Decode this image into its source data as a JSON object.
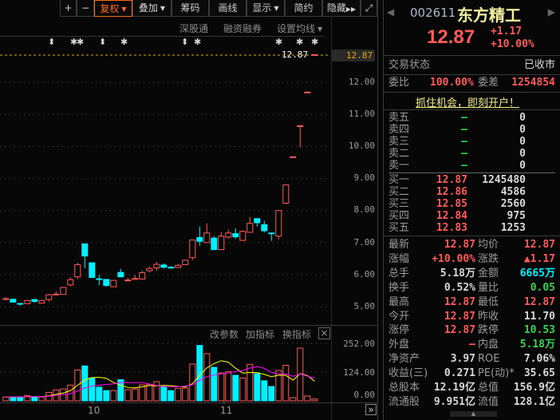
{
  "toolbar": {
    "plus": "+",
    "minus": "−",
    "fuquan": "复权",
    "diejia": "叠加",
    "chouma": "筹码",
    "huaxian": "画线",
    "xianshi": "显示",
    "jianyue": "简约",
    "yincang": "隐藏",
    "fullscreen_icon": "expand-icon"
  },
  "subbar": {
    "sgt": "深股通",
    "rzrq": "融资融券",
    "ma": "设置均线"
  },
  "markers": [
    "⬍",
    "✱",
    "✱",
    "⬍",
    "✱",
    "⬍",
    "✱",
    "✱",
    "✱",
    "✱"
  ],
  "last_label": "12.87",
  "price_axis": {
    "current": "12.87",
    "ticks": [
      "12.00",
      "11.00",
      "10.00",
      "9.00",
      "8.00",
      "7.00",
      "6.00",
      "5.00"
    ]
  },
  "vol_bar": {
    "params": "改参数",
    "add": "加指标",
    "switch": "换指标",
    "close": "×"
  },
  "vol_axis": [
    "252.00",
    "124.00",
    "0.00"
  ],
  "dates": [
    "10",
    "11"
  ],
  "next_btn": "»",
  "chart_data": {
    "type": "candlestick",
    "ylim": [
      5,
      12.87
    ],
    "up_color": "#ff5a5a",
    "down_color": "#00f0ff",
    "ohlc": [
      [
        5.22,
        5.3,
        5.22,
        5.25
      ],
      [
        5.23,
        5.25,
        5.13,
        5.14
      ],
      [
        5.1,
        5.11,
        5.03,
        5.09
      ],
      [
        5.09,
        5.21,
        5.09,
        5.19
      ],
      [
        5.22,
        5.25,
        5.12,
        5.16
      ],
      [
        5.11,
        5.21,
        5.1,
        5.19
      ],
      [
        5.22,
        5.4,
        5.16,
        5.37
      ],
      [
        5.37,
        5.47,
        5.37,
        5.39
      ],
      [
        5.38,
        5.6,
        5.38,
        5.6
      ],
      [
        5.68,
        5.92,
        5.63,
        5.84
      ],
      [
        5.93,
        6.37,
        5.86,
        6.31
      ],
      [
        6.96,
        6.97,
        6.2,
        6.58
      ],
      [
        6.37,
        6.37,
        5.91,
        5.91
      ],
      [
        5.87,
        6.0,
        5.67,
        5.86
      ],
      [
        5.85,
        5.85,
        5.62,
        5.66
      ],
      [
        5.62,
        5.82,
        5.62,
        5.82
      ],
      [
        6.07,
        6.18,
        5.93,
        5.93
      ],
      [
        5.82,
        5.9,
        5.8,
        5.83
      ],
      [
        5.85,
        5.98,
        5.85,
        5.88
      ],
      [
        5.86,
        6.13,
        5.86,
        6.06
      ],
      [
        6.12,
        6.25,
        6.06,
        6.19
      ],
      [
        6.21,
        6.4,
        6.12,
        6.32
      ],
      [
        6.3,
        6.35,
        6.18,
        6.23
      ],
      [
        6.23,
        6.27,
        6.2,
        6.22
      ],
      [
        6.22,
        6.33,
        6.22,
        6.29
      ],
      [
        6.31,
        6.45,
        6.31,
        6.45
      ],
      [
        6.53,
        7.08,
        6.45,
        7.08
      ],
      [
        7.16,
        7.5,
        6.9,
        7.04
      ],
      [
        7.0,
        7.6,
        7.0,
        7.3
      ],
      [
        7.14,
        7.2,
        6.76,
        6.78
      ],
      [
        6.78,
        7.33,
        6.78,
        7.2
      ],
      [
        7.17,
        7.4,
        7.12,
        7.3
      ],
      [
        7.28,
        7.45,
        7.12,
        7.18
      ],
      [
        7.07,
        7.38,
        7.05,
        7.35
      ],
      [
        7.32,
        7.8,
        7.32,
        7.6
      ],
      [
        7.75,
        7.75,
        7.5,
        7.62
      ],
      [
        7.56,
        7.68,
        7.31,
        7.37
      ],
      [
        7.3,
        7.32,
        7.05,
        7.29
      ],
      [
        7.2,
        8.0,
        7.1,
        8.0
      ],
      [
        8.23,
        8.8,
        8.2,
        8.8
      ],
      [
        9.68,
        9.68,
        9.68,
        9.68
      ],
      [
        10.65,
        10.65,
        9.98,
        10.65
      ],
      [
        11.7,
        11.7,
        11.7,
        11.7
      ],
      [
        12.87,
        12.87,
        12.87,
        12.87
      ]
    ],
    "volume": [
      17,
      17,
      17,
      23,
      17,
      17,
      37,
      48,
      52,
      69,
      135,
      153,
      100,
      60,
      45,
      45,
      93,
      49,
      52,
      70,
      72,
      84,
      61,
      45,
      55,
      56,
      161,
      243,
      207,
      147,
      122,
      128,
      112,
      100,
      160,
      119,
      88,
      63,
      133,
      156,
      14,
      231,
      21,
      8
    ],
    "vol_ylim": [
      0,
      252
    ],
    "ma_colors": [
      "#ffff00",
      "#ff00ff"
    ]
  },
  "quote": {
    "code": "002611",
    "name": "东方精工",
    "price": "12.87",
    "change": "+1.17",
    "pct": "+10.00%"
  },
  "status": {
    "label": "交易状态",
    "value": "已收市"
  },
  "weibi": {
    "label": "委比",
    "value": "100.00%",
    "label2": "委差",
    "value2": "1254854"
  },
  "promo": "抓住机会，即刻开户！",
  "sell": [
    {
      "l": "卖五",
      "p": "—",
      "v": "0"
    },
    {
      "l": "卖四",
      "p": "—",
      "v": "0"
    },
    {
      "l": "卖三",
      "p": "—",
      "v": "0"
    },
    {
      "l": "卖二",
      "p": "—",
      "v": "0"
    },
    {
      "l": "卖一",
      "p": "—",
      "v": "0"
    }
  ],
  "buy": [
    {
      "l": "买一",
      "p": "12.87",
      "v": "1245480"
    },
    {
      "l": "买二",
      "p": "12.86",
      "v": "4586"
    },
    {
      "l": "买三",
      "p": "12.85",
      "v": "2560"
    },
    {
      "l": "买四",
      "p": "12.84",
      "v": "975"
    },
    {
      "l": "买五",
      "p": "12.83",
      "v": "1253"
    }
  ],
  "stats": [
    {
      "l1": "最新",
      "v1": "12.87",
      "c1": "red",
      "l2": "均价",
      "v2": "12.87",
      "c2": "red"
    },
    {
      "l1": "涨幅",
      "v1": "+10.00%",
      "c1": "red",
      "l2": "涨跌",
      "v2": "▲1.17",
      "c2": "red"
    },
    {
      "l1": "总手",
      "v1": "5.18万",
      "c1": "wht",
      "l2": "金额",
      "v2": "6665万",
      "c2": "cyn"
    },
    {
      "l1": "换手",
      "v1": "0.52%",
      "c1": "wht",
      "l2": "量比",
      "v2": "0.05",
      "c2": "grn"
    },
    {
      "l1": "最高",
      "v1": "12.87",
      "c1": "red",
      "l2": "最低",
      "v2": "12.87",
      "c2": "red"
    },
    {
      "l1": "今开",
      "v1": "12.87",
      "c1": "red",
      "l2": "昨收",
      "v2": "11.70",
      "c2": "wht"
    },
    {
      "l1": "涨停",
      "v1": "12.87",
      "c1": "red",
      "l2": "跌停",
      "v2": "10.53",
      "c2": "grn"
    },
    {
      "l1": "外盘",
      "v1": "—",
      "c1": "red",
      "l2": "内盘",
      "v2": "5.18万",
      "c2": "grn"
    },
    {
      "l1": "净资产",
      "v1": "3.97",
      "c1": "wht",
      "l2": "ROE",
      "v2": "7.06%",
      "c2": "wht"
    },
    {
      "l1": "收益(三)",
      "v1": "0.271",
      "c1": "wht",
      "l2": "PE(动)*",
      "v2": "35.65",
      "c2": "wht"
    },
    {
      "l1": "总股本",
      "v1": "12.19亿",
      "c1": "wht",
      "l2": "总值",
      "v2": "156.9亿",
      "c2": "wht"
    },
    {
      "l1": "流通股",
      "v1": "9.951亿",
      "c1": "wht",
      "l2": "流值",
      "v2": "128.1亿",
      "c2": "wht"
    }
  ]
}
